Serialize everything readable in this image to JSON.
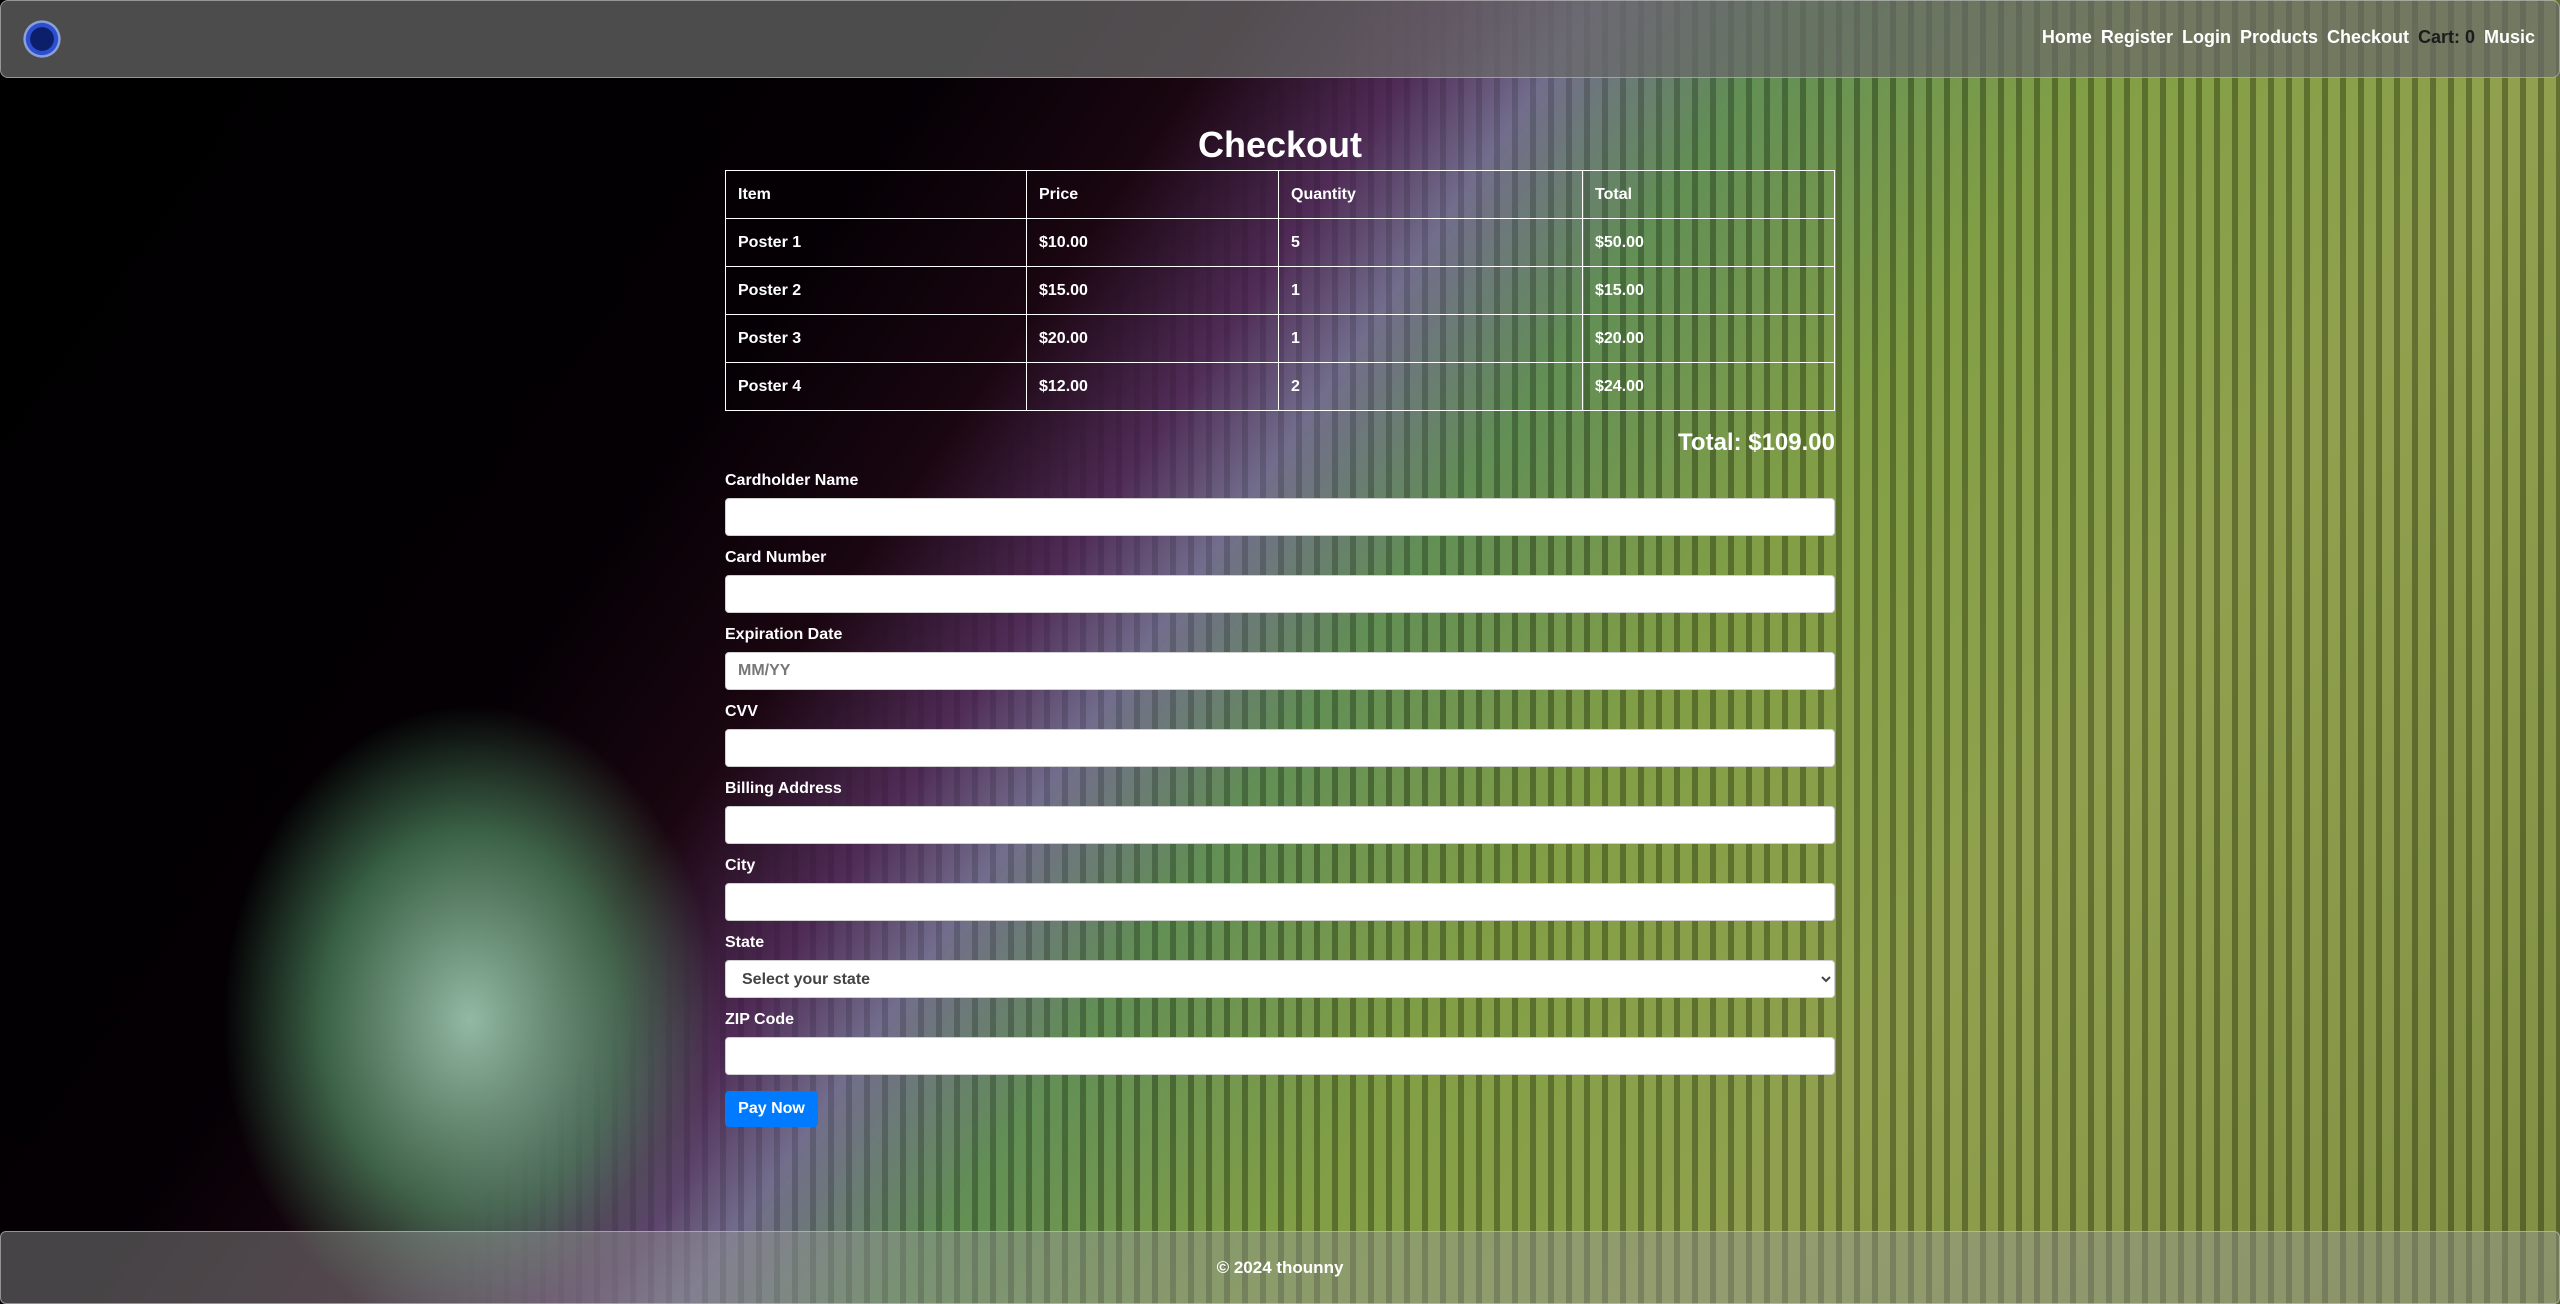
{
  "nav": {
    "links": [
      "Home",
      "Register",
      "Login",
      "Products",
      "Checkout"
    ],
    "cart_label": "Cart: 0",
    "music_label": "Music"
  },
  "page": {
    "title": "Checkout"
  },
  "table": {
    "headers": [
      "Item",
      "Price",
      "Quantity",
      "Total"
    ],
    "rows": [
      [
        "Poster 1",
        "$10.00",
        "5",
        "$50.00"
      ],
      [
        "Poster 2",
        "$15.00",
        "1",
        "$15.00"
      ],
      [
        "Poster 3",
        "$20.00",
        "1",
        "$20.00"
      ],
      [
        "Poster 4",
        "$12.00",
        "2",
        "$24.00"
      ]
    ]
  },
  "summary": {
    "total": "Total: $109.00"
  },
  "form": {
    "cardholder_label": "Cardholder Name",
    "card_number_label": "Card Number",
    "expiration_label": "Expiration Date",
    "expiration_placeholder": "MM/YY",
    "cvv_label": "CVV",
    "address_label": "Billing Address",
    "city_label": "City",
    "state_label": "State",
    "state_selected": "Select your state",
    "zip_label": "ZIP Code",
    "pay_label": "Pay Now"
  },
  "footer": {
    "text": "© 2024 thounny"
  },
  "colors": {
    "accent": "#007bff"
  }
}
